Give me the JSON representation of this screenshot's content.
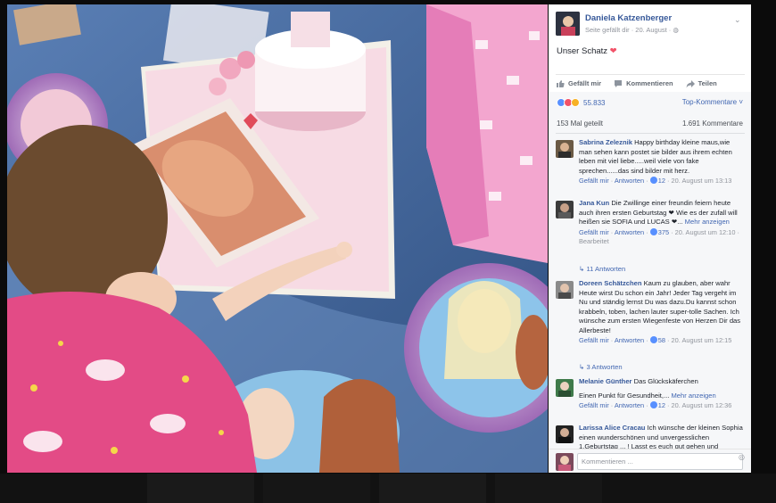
{
  "post": {
    "author": "Daniela Katzenberger",
    "meta": "Seite gefällt dir · 20. August ·",
    "text": "Unser Schatz",
    "text_emoji": "❤"
  },
  "actions": {
    "like": "Gefällt mir",
    "comment": "Kommentieren",
    "share": "Teilen"
  },
  "stats": {
    "reaction_count": "55.833",
    "top_comments": "Top-Kommentare ˅",
    "shares": "153 Mal geteilt",
    "comments": "1.691 Kommentare"
  },
  "comments": [
    {
      "name": "Sabrina Zeleznik",
      "text": "Happy birthday kleine maus,wie man sehen kann postet sie bilder aus ihrem echten leben mit viel liebe.....weil viele von fake sprechen......das sind bilder mit herz.",
      "like": "Gefällt mir",
      "reply": "Antworten",
      "likes": "12",
      "time": "20. August um 13:13",
      "more": "",
      "replies": ""
    },
    {
      "name": "Jana Kun",
      "text": "Die Zwillinge einer freundin feiern heute auch ihren ersten Geburtstag ❤ Wie es der zufall will heißen sie SOFIA und LUCAS ❤...",
      "more": "Mehr anzeigen",
      "like": "Gefällt mir",
      "reply": "Antworten",
      "likes": "375",
      "time": "20. August um 12:10 · Bearbeitet",
      "replies": "11 Antworten"
    },
    {
      "name": "Doreen Schätzchen",
      "text": "Kaum zu glauben, aber wahr Heute wirst Du schon ein Jahr! Jeder Tag vergeht im Nu und ständig lernst Du was dazu.Du kannst schon krabbeln, toben, lachen lauter super-tolle Sachen. Ich wünsche zum ersten Wiegenfeste von Herzen Dir das Allerbeste!",
      "like": "Gefällt mir",
      "reply": "Antworten",
      "likes": "58",
      "time": "20. August um 12:15",
      "more": "",
      "replies": "3 Antworten"
    },
    {
      "name": "Melanie Günther",
      "text": "Das Glückskäferchen",
      "text2": "Einen Punkt für Gesundheit,...",
      "more": "Mehr anzeigen",
      "like": "Gefällt mir",
      "reply": "Antworten",
      "likes": "12",
      "time": "20. August um 12:36",
      "replies": ""
    },
    {
      "name": "Larissa Alice Cracau",
      "text": "Ich wünsche der kleinen Sophia einen wunderschönen und unvergesslichen 1.Geburtstag ... ! Lasst es euch gut gehen und"
    }
  ],
  "composer": {
    "placeholder": "Kommentieren ..."
  },
  "colors": {
    "link": "#365899",
    "accent": "#4267b2",
    "heart": "#f25268",
    "panel_bg": "#f6f7f9"
  }
}
